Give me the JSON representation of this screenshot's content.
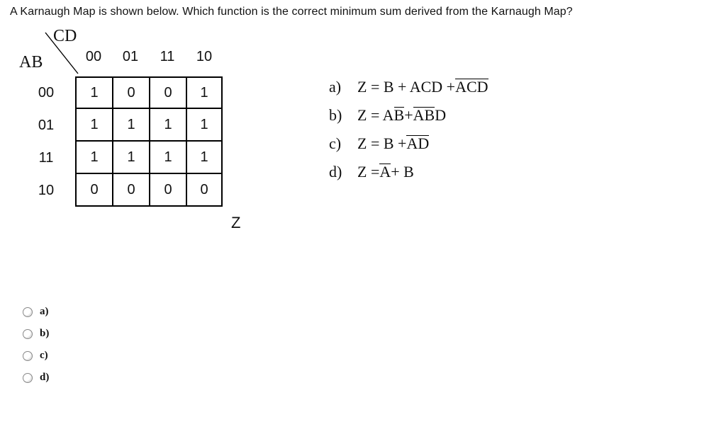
{
  "prompt": "A Karnaugh Map is shown below.  Which function is the correct minimum sum derived from the Karnaugh Map?",
  "kmap": {
    "col_var": "CD",
    "row_var": "AB",
    "col_headers": [
      "00",
      "01",
      "11",
      "10"
    ],
    "row_headers": [
      "00",
      "01",
      "11",
      "10"
    ],
    "cells": [
      [
        "1",
        "0",
        "0",
        "1"
      ],
      [
        "1",
        "1",
        "1",
        "1"
      ],
      [
        "1",
        "1",
        "1",
        "1"
      ],
      [
        "0",
        "0",
        "0",
        "0"
      ]
    ],
    "output_label": "Z"
  },
  "options": {
    "a": {
      "label": "a)",
      "prefix": "Z = B + ACD + ",
      "overline": "ACD",
      "tail": ""
    },
    "b": {
      "label": "b)",
      "prefix": "Z = A",
      "overline1": "B",
      "mid": " + ",
      "overline2": "AB",
      "tail": "D"
    },
    "c": {
      "label": "c)",
      "prefix": "Z = B + ",
      "overline": "AD",
      "tail": ""
    },
    "d": {
      "label": "d)",
      "prefix": "Z = ",
      "overline": "A",
      "tail": " + B"
    }
  },
  "answers": [
    "a)",
    "b)",
    "c)",
    "d)"
  ]
}
